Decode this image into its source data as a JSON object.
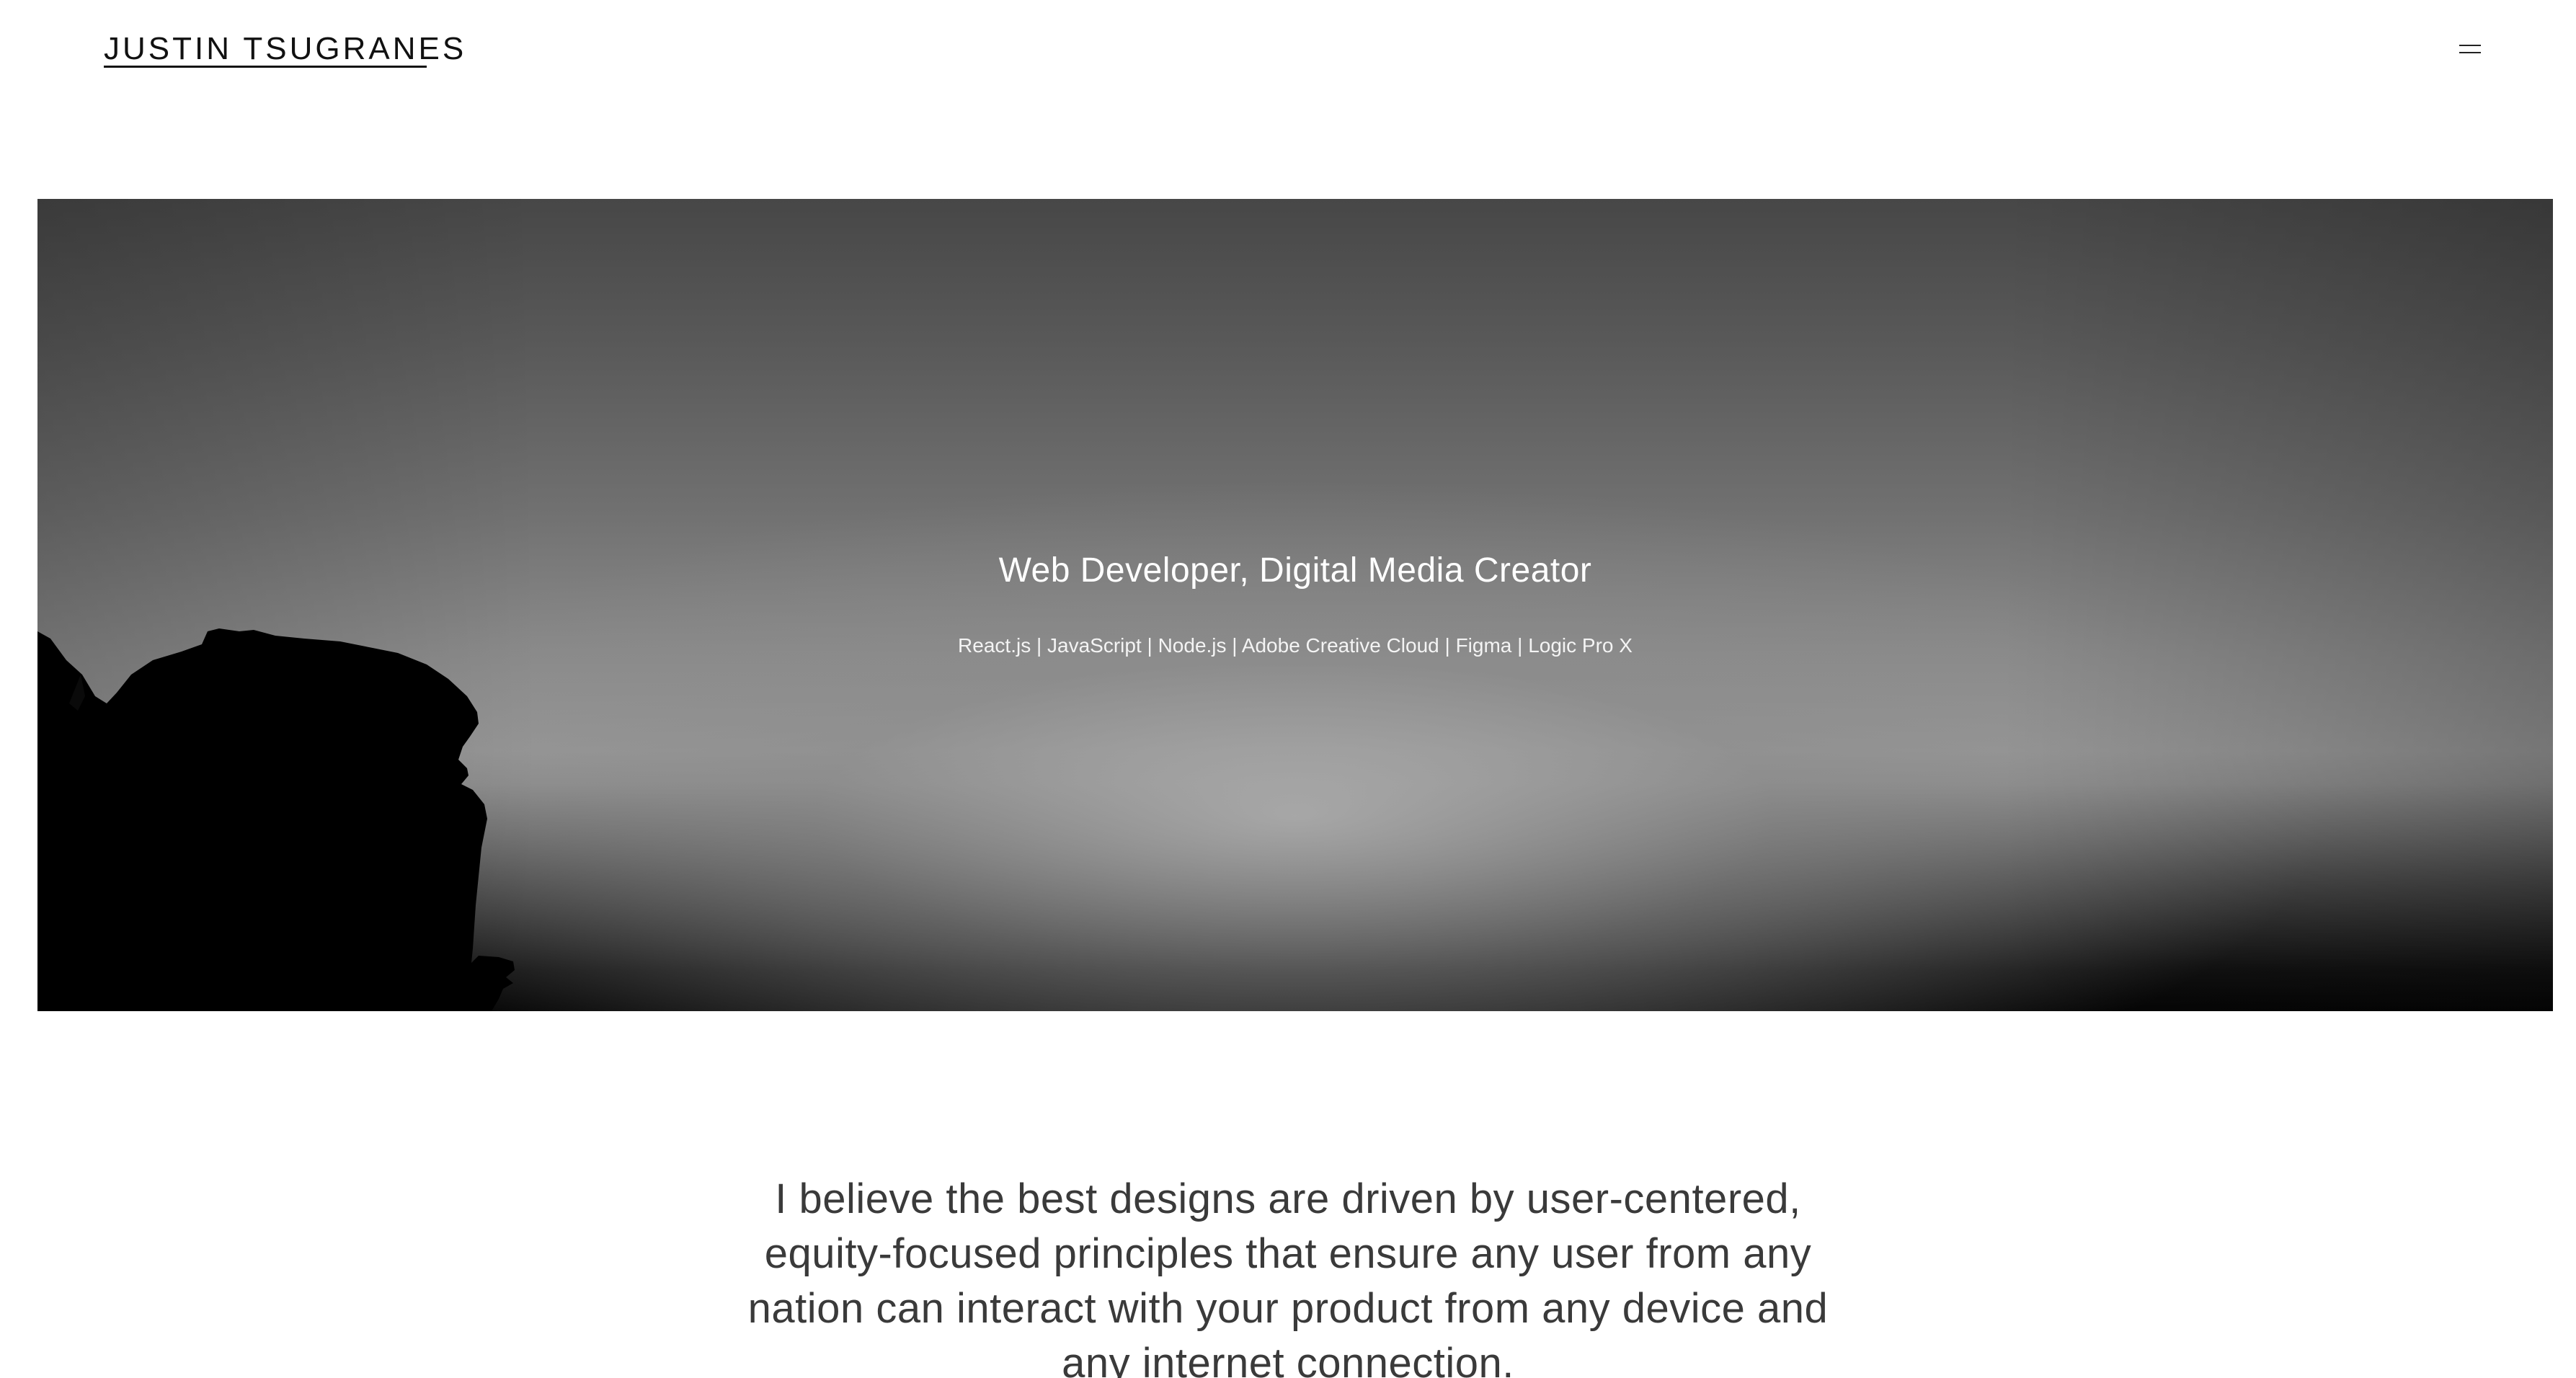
{
  "header": {
    "logo_text": "JUSTIN TSUGRANES",
    "menu_icon": "menu-icon"
  },
  "hero": {
    "title": "Web Developer, Digital Media Creator",
    "skills": "React.js | JavaScript | Node.js | Adobe Creative Cloud | Figma | Logic Pro X",
    "background_description_colors": {
      "sky_top": "#474747",
      "horizon_glow": "#979797",
      "ground": "#050505"
    }
  },
  "statement": {
    "text": "I believe the best designs are driven by user-centered, equity-focused principles that ensure any user from any nation can interact with your product from any device and any internet connection."
  },
  "colors": {
    "text": "#111111",
    "statement_text": "#3a3a3a",
    "background": "#ffffff"
  }
}
